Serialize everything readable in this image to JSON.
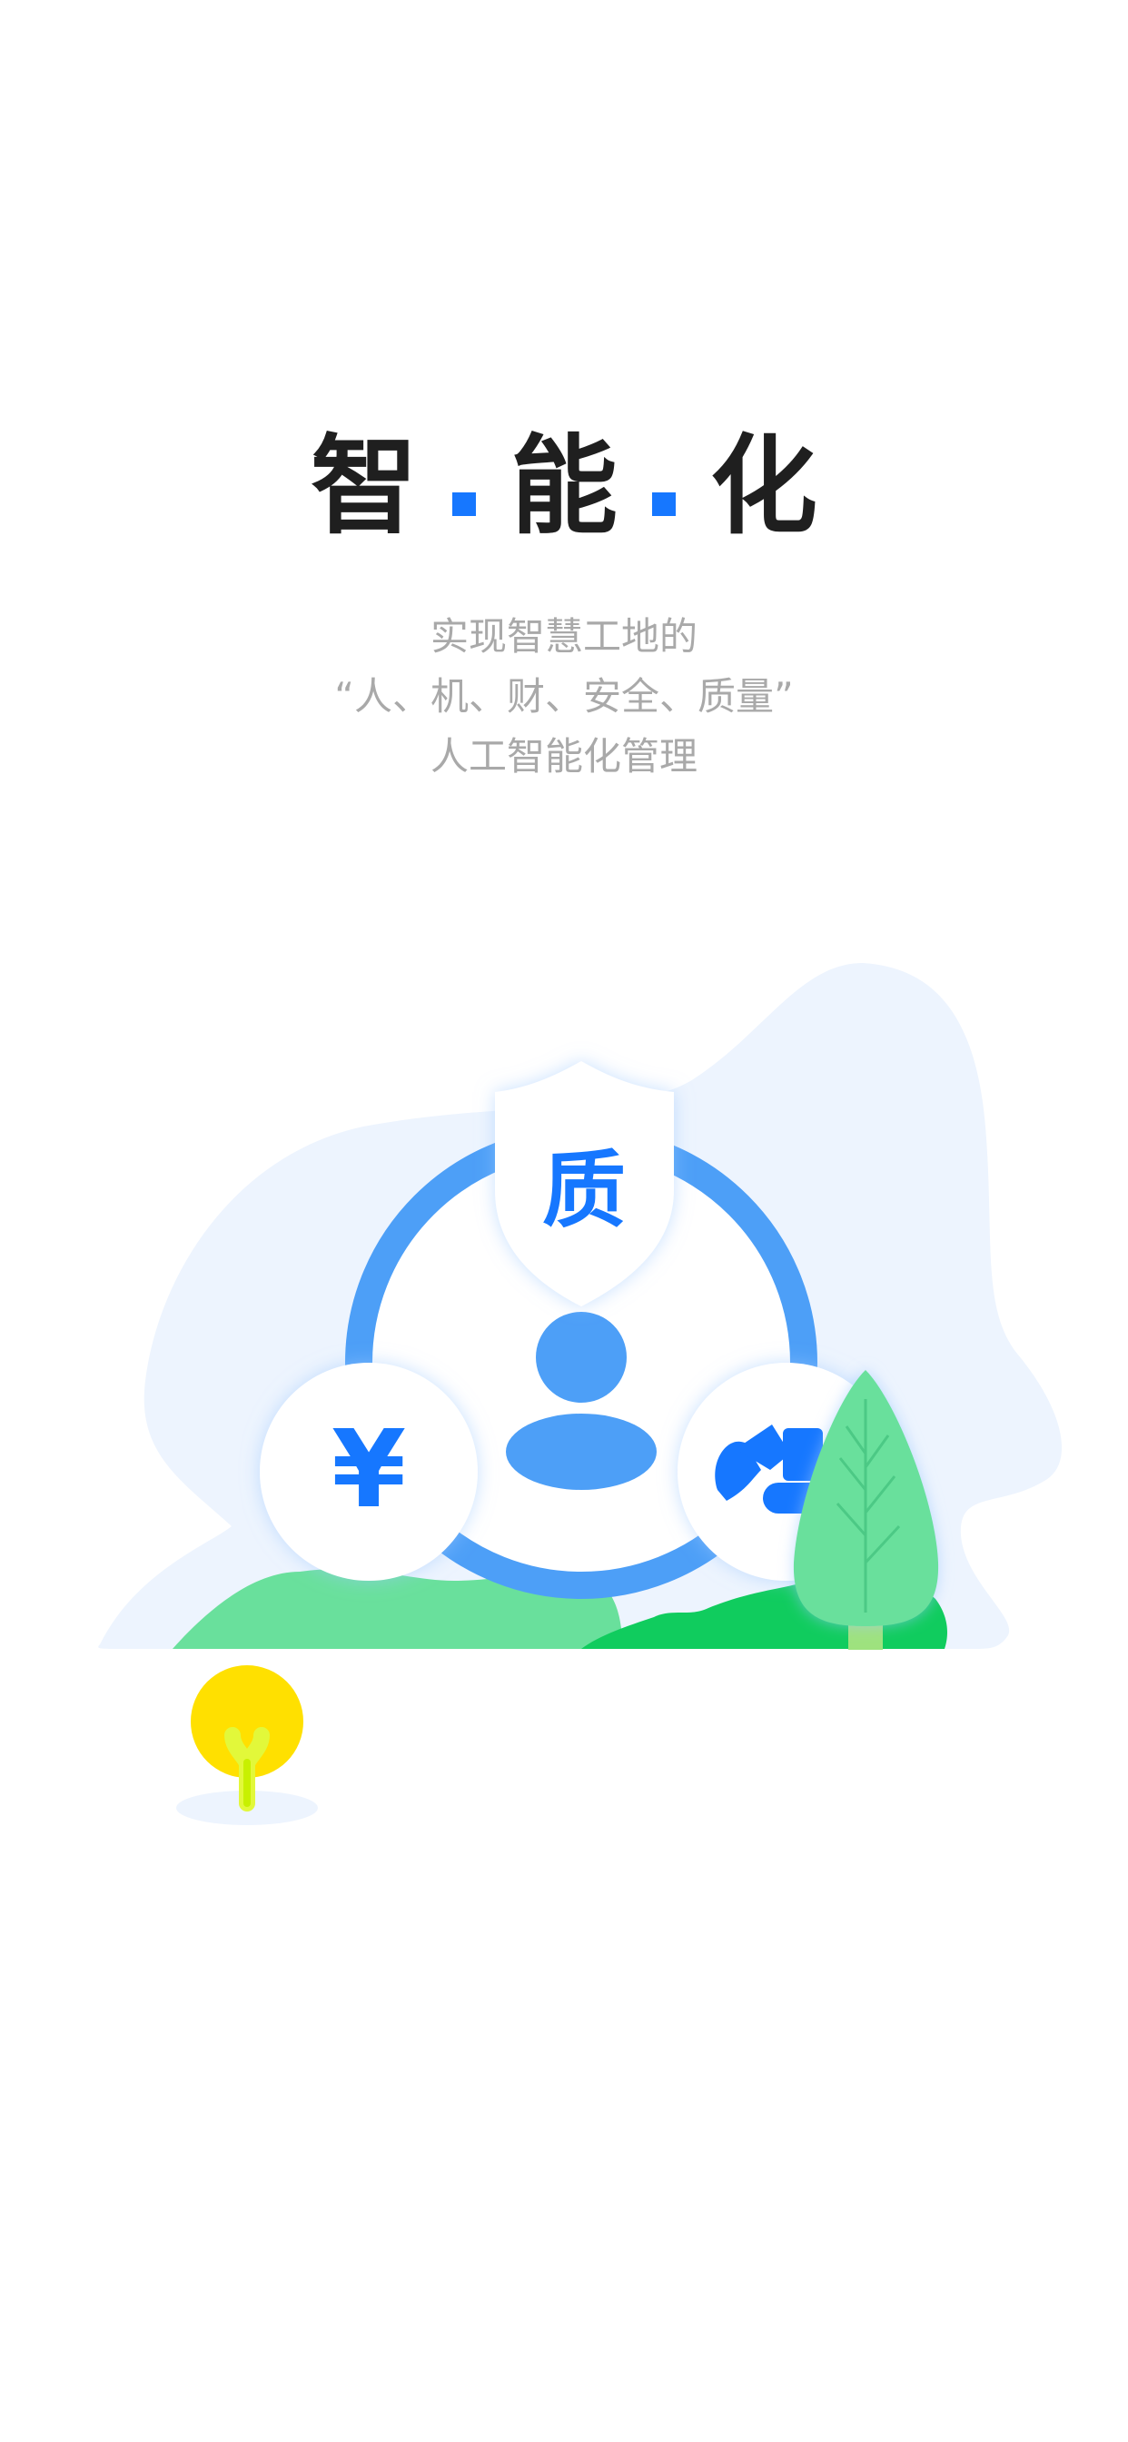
{
  "title": {
    "chars": [
      "智",
      "能",
      "化"
    ]
  },
  "subtitle": {
    "line1": "实现智慧工地的",
    "line2": "“人、机、财、安全、质量”",
    "line3": "人工智能化管理"
  },
  "illustration": {
    "shield_label": "质",
    "money_symbol": "¥",
    "icons": [
      "quality-shield-icon",
      "person-icon",
      "yuan-icon",
      "excavator-icon",
      "tree-icon",
      "lightbulb-icon"
    ]
  },
  "colors": {
    "accent": "#1677ff",
    "ring": "#4d9ff7",
    "blob": "#edf4fe",
    "hill_light": "#69e09c",
    "hill_dark": "#10cc5e",
    "bulb": "#ffe000",
    "title_text": "#1f1f1f",
    "subtitle_text": "#a9a9a9"
  }
}
